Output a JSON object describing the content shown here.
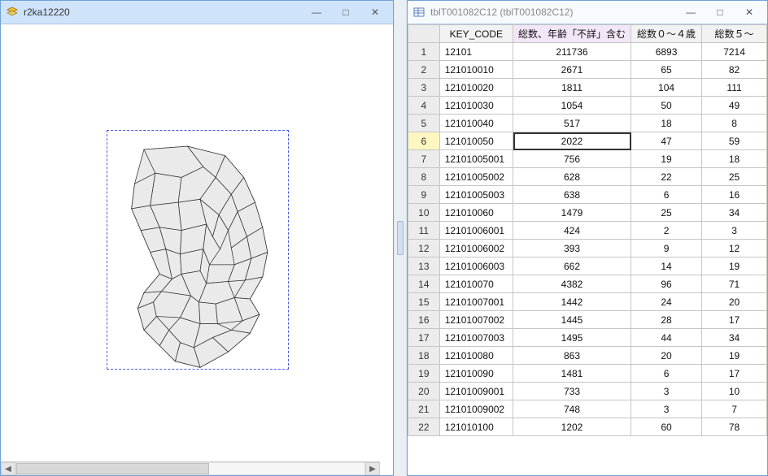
{
  "left_window": {
    "title": "r2ka12220",
    "icon": "map-layer-icon"
  },
  "right_window": {
    "title": "tblT001082C12 (tblT001082C12)",
    "icon": "table-icon"
  },
  "table": {
    "columns": [
      "KEY_CODE",
      "総数、年齢「不詳」含む",
      "総数０～４歳",
      "総数５～"
    ],
    "highlight_col_index": 1,
    "highlight_row_index": 5,
    "selected_cell": {
      "row": 5,
      "col": 1
    },
    "rows": [
      {
        "n": 1,
        "key": "12101",
        "v": [
          "211736",
          "6893",
          "7214"
        ]
      },
      {
        "n": 2,
        "key": "121010010",
        "v": [
          "2671",
          "65",
          "82"
        ]
      },
      {
        "n": 3,
        "key": "121010020",
        "v": [
          "1811",
          "104",
          "111"
        ]
      },
      {
        "n": 4,
        "key": "121010030",
        "v": [
          "1054",
          "50",
          "49"
        ]
      },
      {
        "n": 5,
        "key": "121010040",
        "v": [
          "517",
          "18",
          "8"
        ]
      },
      {
        "n": 6,
        "key": "121010050",
        "v": [
          "2022",
          "47",
          "59"
        ]
      },
      {
        "n": 7,
        "key": "12101005001",
        "v": [
          "756",
          "19",
          "18"
        ]
      },
      {
        "n": 8,
        "key": "12101005002",
        "v": [
          "628",
          "22",
          "25"
        ]
      },
      {
        "n": 9,
        "key": "12101005003",
        "v": [
          "638",
          "6",
          "16"
        ]
      },
      {
        "n": 10,
        "key": "121010060",
        "v": [
          "1479",
          "25",
          "34"
        ]
      },
      {
        "n": 11,
        "key": "12101006001",
        "v": [
          "424",
          "2",
          "3"
        ]
      },
      {
        "n": 12,
        "key": "12101006002",
        "v": [
          "393",
          "9",
          "12"
        ]
      },
      {
        "n": 13,
        "key": "12101006003",
        "v": [
          "662",
          "14",
          "19"
        ]
      },
      {
        "n": 14,
        "key": "121010070",
        "v": [
          "4382",
          "96",
          "71"
        ]
      },
      {
        "n": 15,
        "key": "12101007001",
        "v": [
          "1442",
          "24",
          "20"
        ]
      },
      {
        "n": 16,
        "key": "12101007002",
        "v": [
          "1445",
          "28",
          "17"
        ]
      },
      {
        "n": 17,
        "key": "12101007003",
        "v": [
          "1495",
          "44",
          "34"
        ]
      },
      {
        "n": 18,
        "key": "121010080",
        "v": [
          "863",
          "20",
          "19"
        ]
      },
      {
        "n": 19,
        "key": "121010090",
        "v": [
          "1481",
          "6",
          "17"
        ]
      },
      {
        "n": 20,
        "key": "12101009001",
        "v": [
          "733",
          "3",
          "10"
        ]
      },
      {
        "n": 21,
        "key": "12101009002",
        "v": [
          "748",
          "3",
          "7"
        ]
      },
      {
        "n": 22,
        "key": "121010100",
        "v": [
          "1202",
          "60",
          "78"
        ]
      }
    ]
  },
  "glyphs": {
    "min": "—",
    "max": "□",
    "close": "✕",
    "left": "◀",
    "right": "▶"
  }
}
